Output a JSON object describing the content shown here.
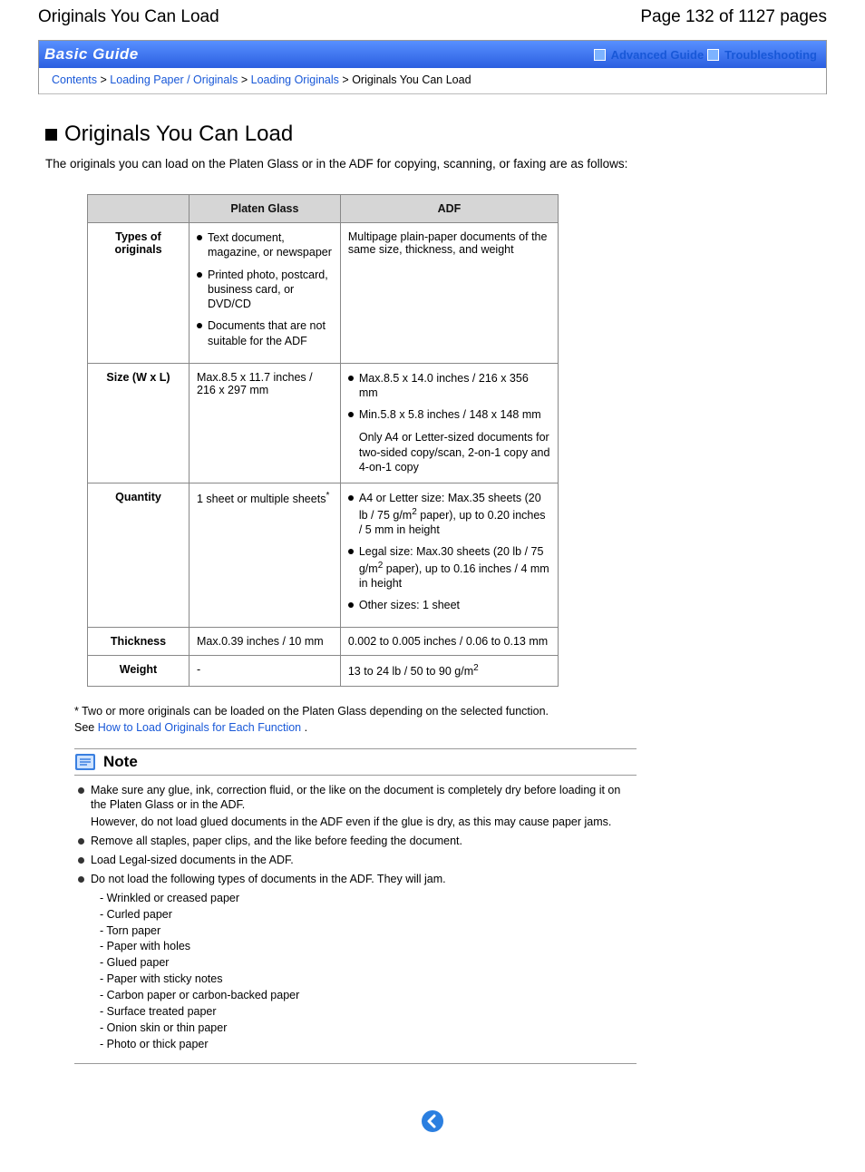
{
  "header": {
    "doc_title": "Originals You Can Load",
    "page_indicator": "Page 132 of 1127 pages"
  },
  "banner": {
    "title": "Basic Guide",
    "link_advanced": "Advanced Guide",
    "link_trouble": "Troubleshooting"
  },
  "breadcrumb": {
    "contents": "Contents",
    "sep": " > ",
    "l1": "Loading Paper / Originals",
    "l2": "Loading Originals",
    "current": "Originals You Can Load"
  },
  "main": {
    "title": "Originals You Can Load",
    "intro": "The originals you can load on the Platen Glass or in the ADF for copying, scanning, or faxing are as follows:"
  },
  "table": {
    "col1": "Platen Glass",
    "col2": "ADF",
    "rows": {
      "types": {
        "label": "Types of originals",
        "platen": {
          "i1": "Text document, magazine, or newspaper",
          "i2": "Printed photo, postcard, business card, or DVD/CD",
          "i3": "Documents that are not suitable for the ADF"
        },
        "adf": "Multipage plain-paper documents of the same size, thickness, and weight"
      },
      "size": {
        "label": "Size (W x L)",
        "platen": "Max.8.5 x 11.7 inches / 216 x 297 mm",
        "adf": {
          "i1": "Max.8.5 x 14.0 inches / 216 x 356 mm",
          "i2": "Min.5.8 x 5.8 inches / 148 x 148 mm",
          "note": "Only A4 or Letter-sized documents for two-sided copy/scan, 2-on-1 copy and 4-on-1 copy"
        }
      },
      "qty": {
        "label": "Quantity",
        "platen": "1 sheet or multiple sheets",
        "adf": {
          "i1a": "A4 or Letter size: Max.35 sheets (20 lb / 75 g/m",
          "i1b": " paper), up to 0.20 inches / 5 mm in height",
          "i2a": "Legal size: Max.30 sheets (20 lb / 75 g/m",
          "i2b": " paper), up to 0.16 inches / 4 mm in height",
          "i3": "Other sizes: 1 sheet"
        }
      },
      "thick": {
        "label": "Thickness",
        "platen": "Max.0.39 inches / 10 mm",
        "adf": "0.002 to 0.005 inches / 0.06 to 0.13 mm"
      },
      "weight": {
        "label": "Weight",
        "platen": "-",
        "adf_a": "13 to 24 lb / 50 to 90 g/m"
      }
    }
  },
  "footnote": "* Two or more originals can be loaded on the Platen Glass depending on the selected function.",
  "see": {
    "label": "See ",
    "link": "How to Load Originals for Each Function",
    "tail": " ."
  },
  "note": {
    "title": "Note",
    "n1": "Make sure any glue, ink, correction fluid, or the like on the document is completely dry before loading it on the Platen Glass or in the ADF.",
    "n1b": "However, do not load glued documents in the ADF even if the glue is dry, as this may cause paper jams.",
    "n2": "Remove all staples, paper clips, and the like before feeding the document.",
    "n3": "Load Legal-sized documents in the ADF.",
    "n4": "Do not load the following types of documents in the ADF. They will jam.",
    "jamlist": {
      "j1": "- Wrinkled or creased paper",
      "j2": "- Curled paper",
      "j3": "- Torn paper",
      "j4": "- Paper with holes",
      "j5": "- Glued paper",
      "j6": "- Paper with sticky notes",
      "j7": "- Carbon paper or carbon-backed paper",
      "j8": "- Surface treated paper",
      "j9": "- Onion skin or thin paper",
      "j10": "- Photo or thick paper"
    }
  }
}
